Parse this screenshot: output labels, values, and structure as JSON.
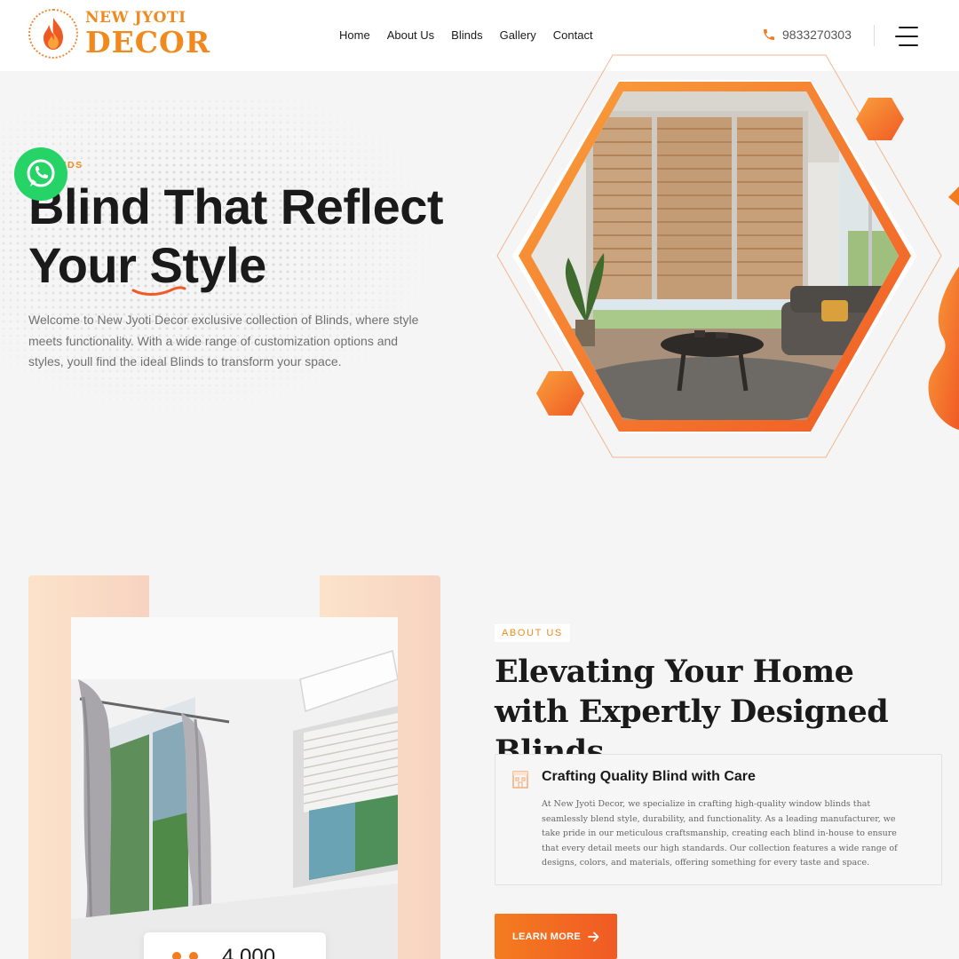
{
  "brand": {
    "line1": "NEW JYOTI",
    "line2": "DECOR"
  },
  "nav": {
    "items": [
      "Home",
      "About Us",
      "Blinds",
      "Gallery",
      "Contact"
    ]
  },
  "header": {
    "phone": "9833270303",
    "phone_icon": "phone-icon",
    "menu_icon": "hamburger-menu-icon"
  },
  "hero": {
    "eyebrow": "H BLINDS",
    "title_line1": "Blind That Reflect",
    "title_line2": "Your Style",
    "description": "Welcome to New Jyoti Decor exclusive collection of Blinds, where style meets functionality. With a wide range of customization options and styles, youll find the ideal Blinds to transform your space."
  },
  "floating": {
    "whatsapp_icon": "whatsapp-icon"
  },
  "about": {
    "tag": "ABOUT US",
    "title": "Elevating Your Home with Expertly Designed Blinds",
    "card_title": "Crafting Quality Blind with Care",
    "card_text": "At New Jyoti Decor, we specialize in crafting high-quality window blinds that seamlessly blend style, durability, and functionality. As a leading manufacturer, we take pride in our meticulous craftsmanship, creating each blind in-house to ensure that every detail meets our high standards. Our collection features a wide range of designs, colors, and materials, offering something for every taste and space.",
    "button_label": "LEARN MORE",
    "stat_value": "4,000"
  },
  "colors": {
    "accent": "#f47c20",
    "accent_dark": "#f05a24",
    "text": "#1a1a1a",
    "whatsapp": "#25d366"
  }
}
